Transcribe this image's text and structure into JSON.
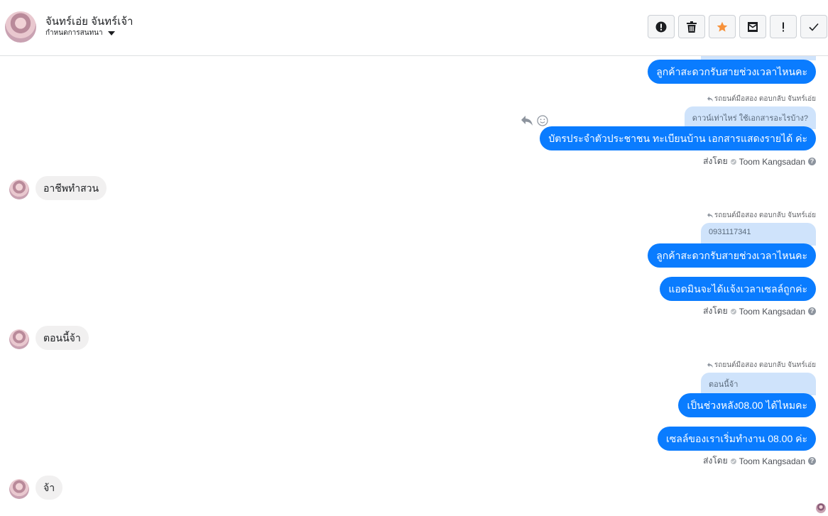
{
  "header": {
    "contact_name": "จันทร์เอ่ย จันทร์เจ้า",
    "conversation_action": "กำหนดการสนทนา",
    "toolbar": [
      {
        "name": "spam-button",
        "icon": "alert-circle-icon"
      },
      {
        "name": "delete-button",
        "icon": "trash-icon"
      },
      {
        "name": "star-button",
        "icon": "star-icon",
        "color": "#f7923b"
      },
      {
        "name": "mark-unread-button",
        "icon": "envelope-icon"
      },
      {
        "name": "important-button",
        "icon": "exclamation-icon"
      },
      {
        "name": "done-button",
        "icon": "check-icon"
      }
    ]
  },
  "thread": {
    "top_partial_message": "ลูกค้าสะดวกรับสายช่วงเวลาไหนคะ",
    "group1": {
      "reply_label": "รถยนต์มือสอง ตอบกลับ จันทร์เอ่ย",
      "quote": "ดาวน์เท่าไหร่ ใช้เอกสารอะไรบ้าง?",
      "message": "บัตรประจำตัวประชาชน ทะเบียนบ้าน เอกสารแสดงรายได้ ค่ะ",
      "sent_by_prefix": "ส่งโดย",
      "sender": "Toom Kangsadan"
    },
    "incoming1": "อาชีพทำสวน",
    "group2": {
      "reply_label": "รถยนต์มือสอง ตอบกลับ จันทร์เอ่ย",
      "quote": "0931117341",
      "message1": "ลูกค้าสะดวกรับสายช่วงเวลาไหนคะ",
      "message2": "แอดมินจะได้แจ้งเวลาเซลล์ถูกค่ะ",
      "sent_by_prefix": "ส่งโดย",
      "sender": "Toom Kangsadan"
    },
    "incoming2": "ตอนนี้จ้า",
    "group3": {
      "reply_label": "รถยนต์มือสอง ตอบกลับ จันทร์เอ่ย",
      "quote": "ตอนนี้จ้า",
      "message1": "เป็นช่วงหลัง08.00 ได้ไหมคะ",
      "message2": "เซลล์ของเราเริ่มทำงาน 08.00 ค่ะ",
      "sent_by_prefix": "ส่งโดย",
      "sender": "Toom Kangsadan"
    },
    "incoming3": "จ้า"
  },
  "colors": {
    "outgoing_bubble": "#0a7cff",
    "incoming_bubble": "#f1f0f0",
    "quote_bubble": "#cfe3fb"
  }
}
